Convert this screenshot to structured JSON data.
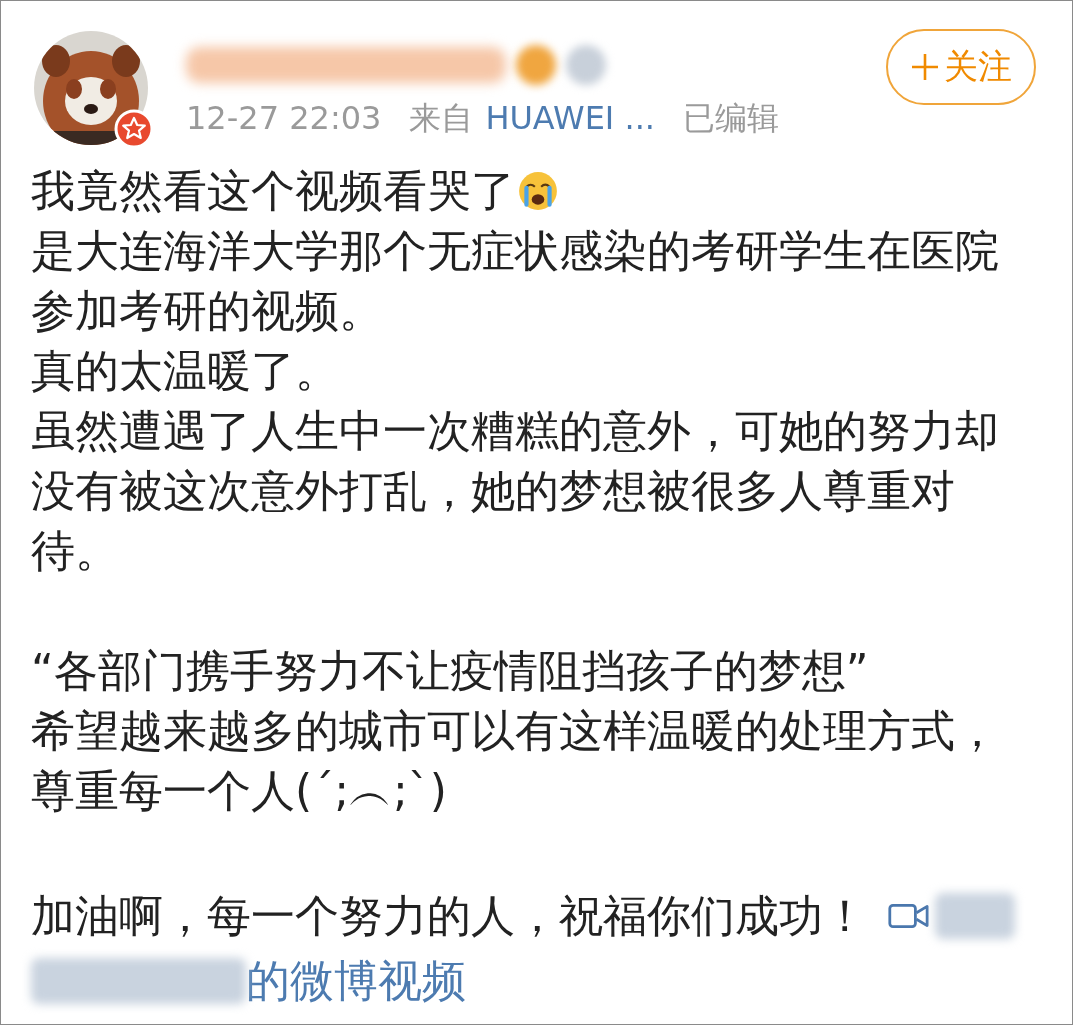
{
  "post": {
    "time": "12-27 22:03",
    "source_prefix": "来自",
    "source": "HUAWEI ...",
    "edited": "已编辑",
    "follow_button": "关注",
    "verified": true
  },
  "lines": [
    {
      "kind": "text",
      "text": "我竟然看这个视频看哭了",
      "emoji": true
    },
    {
      "kind": "text",
      "text": "是大连海洋大学那个无症状感染的考研学生在医院"
    },
    {
      "kind": "text",
      "text": "参加考研的视频。"
    },
    {
      "kind": "text",
      "text": "真的太温暖了。"
    },
    {
      "kind": "text",
      "text": "虽然遭遇了人生中一次糟糕的意外，可她的努力却"
    },
    {
      "kind": "text",
      "text": "没有被这次意外打乱，她的梦想被很多人尊重对"
    },
    {
      "kind": "text",
      "text": "待。"
    },
    {
      "kind": "blank"
    },
    {
      "kind": "text",
      "text": "“各部门携手努力不让疫情阻挡孩子的梦想”"
    },
    {
      "kind": "text",
      "text": "希望越来越多的城市可以有这样温暖的处理方式，"
    },
    {
      "kind": "text",
      "text": "尊重每一个人(´;︵;`)"
    },
    {
      "kind": "blank"
    },
    {
      "kind": "text",
      "text": "加油啊，每一个努力的人，祝福你们成功！",
      "video_link": true
    },
    {
      "kind": "link",
      "text": "的微博视频"
    }
  ]
}
